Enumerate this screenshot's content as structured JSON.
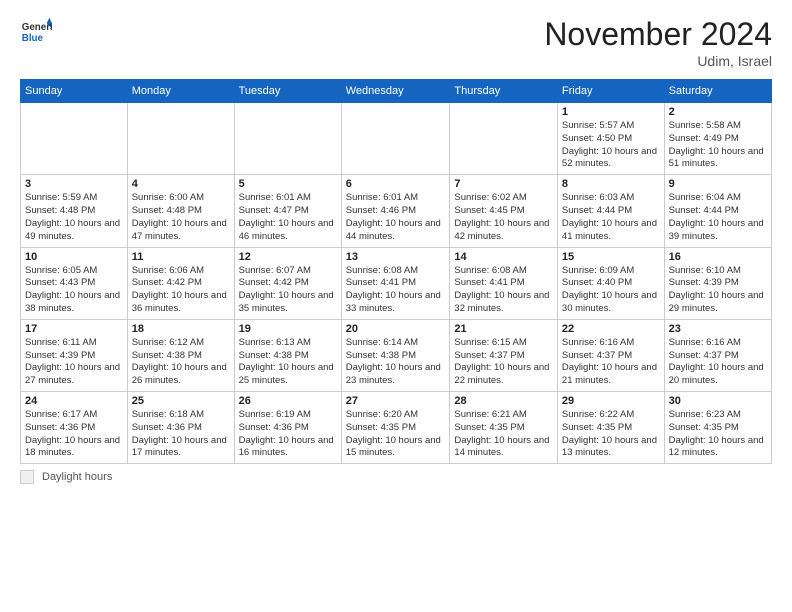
{
  "header": {
    "logo_general": "General",
    "logo_blue": "Blue",
    "month_title": "November 2024",
    "location": "Udim, Israel"
  },
  "footer": {
    "legend_label": "Daylight hours"
  },
  "columns": [
    "Sunday",
    "Monday",
    "Tuesday",
    "Wednesday",
    "Thursday",
    "Friday",
    "Saturday"
  ],
  "weeks": [
    [
      {
        "num": "",
        "info": ""
      },
      {
        "num": "",
        "info": ""
      },
      {
        "num": "",
        "info": ""
      },
      {
        "num": "",
        "info": ""
      },
      {
        "num": "",
        "info": ""
      },
      {
        "num": "1",
        "info": "Sunrise: 5:57 AM\nSunset: 4:50 PM\nDaylight: 10 hours and 52 minutes."
      },
      {
        "num": "2",
        "info": "Sunrise: 5:58 AM\nSunset: 4:49 PM\nDaylight: 10 hours and 51 minutes."
      }
    ],
    [
      {
        "num": "3",
        "info": "Sunrise: 5:59 AM\nSunset: 4:48 PM\nDaylight: 10 hours and 49 minutes."
      },
      {
        "num": "4",
        "info": "Sunrise: 6:00 AM\nSunset: 4:48 PM\nDaylight: 10 hours and 47 minutes."
      },
      {
        "num": "5",
        "info": "Sunrise: 6:01 AM\nSunset: 4:47 PM\nDaylight: 10 hours and 46 minutes."
      },
      {
        "num": "6",
        "info": "Sunrise: 6:01 AM\nSunset: 4:46 PM\nDaylight: 10 hours and 44 minutes."
      },
      {
        "num": "7",
        "info": "Sunrise: 6:02 AM\nSunset: 4:45 PM\nDaylight: 10 hours and 42 minutes."
      },
      {
        "num": "8",
        "info": "Sunrise: 6:03 AM\nSunset: 4:44 PM\nDaylight: 10 hours and 41 minutes."
      },
      {
        "num": "9",
        "info": "Sunrise: 6:04 AM\nSunset: 4:44 PM\nDaylight: 10 hours and 39 minutes."
      }
    ],
    [
      {
        "num": "10",
        "info": "Sunrise: 6:05 AM\nSunset: 4:43 PM\nDaylight: 10 hours and 38 minutes."
      },
      {
        "num": "11",
        "info": "Sunrise: 6:06 AM\nSunset: 4:42 PM\nDaylight: 10 hours and 36 minutes."
      },
      {
        "num": "12",
        "info": "Sunrise: 6:07 AM\nSunset: 4:42 PM\nDaylight: 10 hours and 35 minutes."
      },
      {
        "num": "13",
        "info": "Sunrise: 6:08 AM\nSunset: 4:41 PM\nDaylight: 10 hours and 33 minutes."
      },
      {
        "num": "14",
        "info": "Sunrise: 6:08 AM\nSunset: 4:41 PM\nDaylight: 10 hours and 32 minutes."
      },
      {
        "num": "15",
        "info": "Sunrise: 6:09 AM\nSunset: 4:40 PM\nDaylight: 10 hours and 30 minutes."
      },
      {
        "num": "16",
        "info": "Sunrise: 6:10 AM\nSunset: 4:39 PM\nDaylight: 10 hours and 29 minutes."
      }
    ],
    [
      {
        "num": "17",
        "info": "Sunrise: 6:11 AM\nSunset: 4:39 PM\nDaylight: 10 hours and 27 minutes."
      },
      {
        "num": "18",
        "info": "Sunrise: 6:12 AM\nSunset: 4:38 PM\nDaylight: 10 hours and 26 minutes."
      },
      {
        "num": "19",
        "info": "Sunrise: 6:13 AM\nSunset: 4:38 PM\nDaylight: 10 hours and 25 minutes."
      },
      {
        "num": "20",
        "info": "Sunrise: 6:14 AM\nSunset: 4:38 PM\nDaylight: 10 hours and 23 minutes."
      },
      {
        "num": "21",
        "info": "Sunrise: 6:15 AM\nSunset: 4:37 PM\nDaylight: 10 hours and 22 minutes."
      },
      {
        "num": "22",
        "info": "Sunrise: 6:16 AM\nSunset: 4:37 PM\nDaylight: 10 hours and 21 minutes."
      },
      {
        "num": "23",
        "info": "Sunrise: 6:16 AM\nSunset: 4:37 PM\nDaylight: 10 hours and 20 minutes."
      }
    ],
    [
      {
        "num": "24",
        "info": "Sunrise: 6:17 AM\nSunset: 4:36 PM\nDaylight: 10 hours and 18 minutes."
      },
      {
        "num": "25",
        "info": "Sunrise: 6:18 AM\nSunset: 4:36 PM\nDaylight: 10 hours and 17 minutes."
      },
      {
        "num": "26",
        "info": "Sunrise: 6:19 AM\nSunset: 4:36 PM\nDaylight: 10 hours and 16 minutes."
      },
      {
        "num": "27",
        "info": "Sunrise: 6:20 AM\nSunset: 4:35 PM\nDaylight: 10 hours and 15 minutes."
      },
      {
        "num": "28",
        "info": "Sunrise: 6:21 AM\nSunset: 4:35 PM\nDaylight: 10 hours and 14 minutes."
      },
      {
        "num": "29",
        "info": "Sunrise: 6:22 AM\nSunset: 4:35 PM\nDaylight: 10 hours and 13 minutes."
      },
      {
        "num": "30",
        "info": "Sunrise: 6:23 AM\nSunset: 4:35 PM\nDaylight: 10 hours and 12 minutes."
      }
    ]
  ]
}
